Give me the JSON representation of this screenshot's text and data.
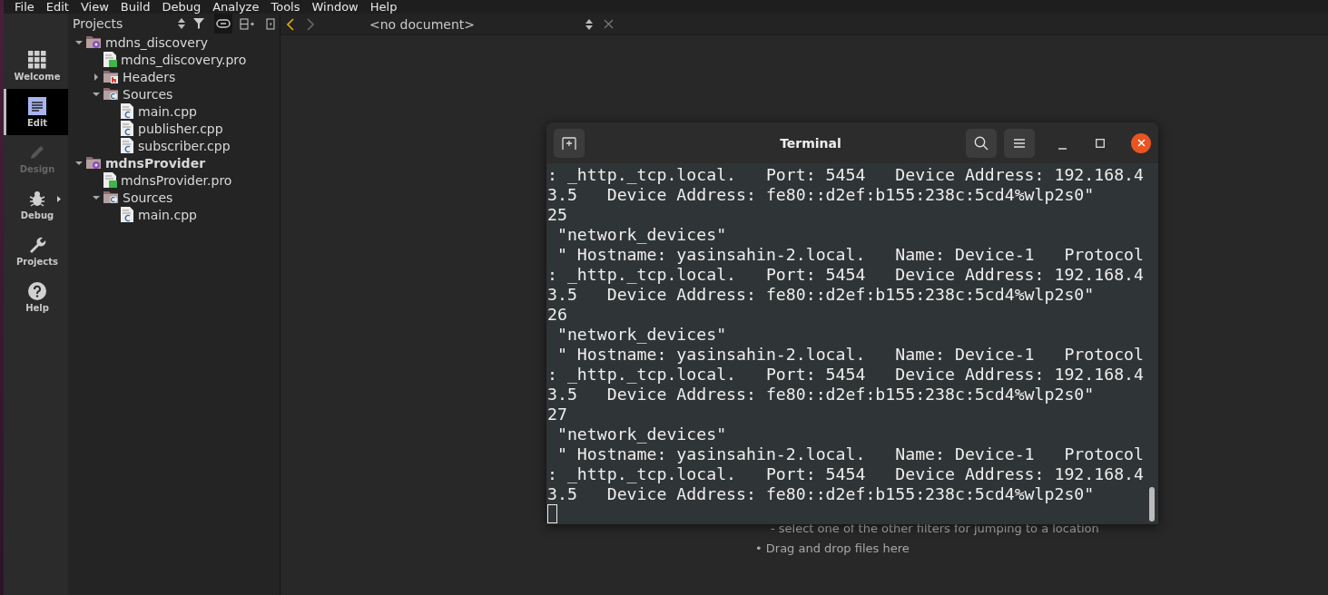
{
  "menu": [
    "File",
    "Edit",
    "View",
    "Build",
    "Debug",
    "Analyze",
    "Tools",
    "Window",
    "Help"
  ],
  "mode_bar": [
    {
      "kind": "welcome",
      "label": "Welcome",
      "selected": false,
      "disabled": false
    },
    {
      "kind": "edit",
      "label": "Edit",
      "selected": true,
      "disabled": false
    },
    {
      "kind": "design",
      "label": "Design",
      "selected": false,
      "disabled": true
    },
    {
      "kind": "debug",
      "label": "Debug",
      "selected": false,
      "disabled": false
    },
    {
      "kind": "projects",
      "label": "Projects",
      "selected": false,
      "disabled": false
    },
    {
      "kind": "help",
      "label": "Help",
      "selected": false,
      "disabled": false
    }
  ],
  "projects_panel": {
    "title": "Projects",
    "tree": [
      {
        "kind": "project",
        "label": "mdns_discovery",
        "active": false,
        "expanded": true,
        "children": [
          {
            "kind": "pro",
            "label": "mdns_discovery.pro"
          },
          {
            "kind": "headers",
            "label": "Headers",
            "expanded": false
          },
          {
            "kind": "sources",
            "label": "Sources",
            "expanded": true,
            "children": [
              {
                "kind": "cpp",
                "label": "main.cpp"
              },
              {
                "kind": "cpp",
                "label": "publisher.cpp"
              },
              {
                "kind": "cpp",
                "label": "subscriber.cpp"
              }
            ]
          }
        ]
      },
      {
        "kind": "project",
        "label": "mdnsProvider",
        "active": true,
        "expanded": true,
        "children": [
          {
            "kind": "pro",
            "label": "mdnsProvider.pro"
          },
          {
            "kind": "sources",
            "label": "Sources",
            "expanded": true,
            "children": [
              {
                "kind": "cpp",
                "label": "main.cpp"
              }
            ]
          }
        ]
      }
    ]
  },
  "editor": {
    "document": "<no document>",
    "hints": [
      "- select one of the other filters for jumping to a location",
      "• Drag and drop files here"
    ]
  },
  "terminal": {
    "title": "Terminal",
    "lines": [
      ": _http._tcp.local.   Port: 5454   Device Address: 192.168.4",
      "3.5   Device Address: fe80::d2ef:b155:238c:5cd4%wlp2s0\"",
      "25",
      " \"network_devices\"",
      " \" Hostname: yasinsahin-2.local.   Name: Device-1   Protocol",
      ": _http._tcp.local.   Port: 5454   Device Address: 192.168.4",
      "3.5   Device Address: fe80::d2ef:b155:238c:5cd4%wlp2s0\"",
      "26",
      " \"network_devices\"",
      " \" Hostname: yasinsahin-2.local.   Name: Device-1   Protocol",
      ": _http._tcp.local.   Port: 5454   Device Address: 192.168.4",
      "3.5   Device Address: fe80::d2ef:b155:238c:5cd4%wlp2s0\"",
      "27",
      " \"network_devices\"",
      " \" Hostname: yasinsahin-2.local.   Name: Device-1   Protocol",
      ": _http._tcp.local.   Port: 5454   Device Address: 192.168.4",
      "3.5   Device Address: fe80::d2ef:b155:238c:5cd4%wlp2s0\""
    ]
  }
}
